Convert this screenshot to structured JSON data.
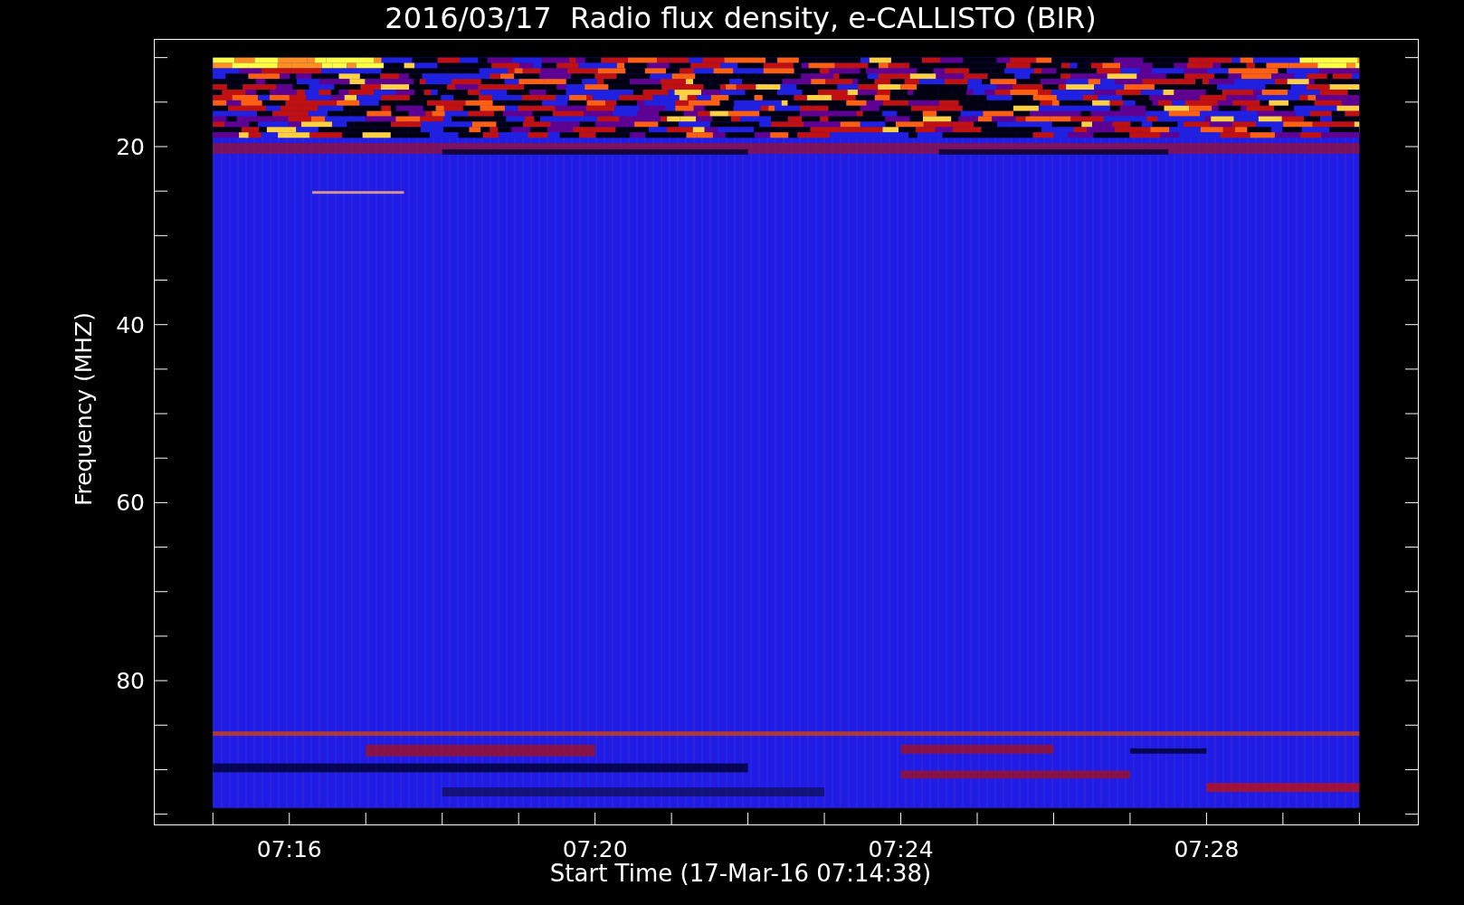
{
  "plot": {
    "title": "2016/03/17  Radio flux density, e-CALLISTO (BIR)",
    "ylabel": "Frequency (MHZ)",
    "xlabel": "Start Time (17-Mar-16 07:14:38)",
    "y_tick_labels": [
      "20",
      "40",
      "60",
      "80"
    ],
    "x_tick_labels": [
      "07:16",
      "07:20",
      "07:24",
      "07:28"
    ]
  }
}
